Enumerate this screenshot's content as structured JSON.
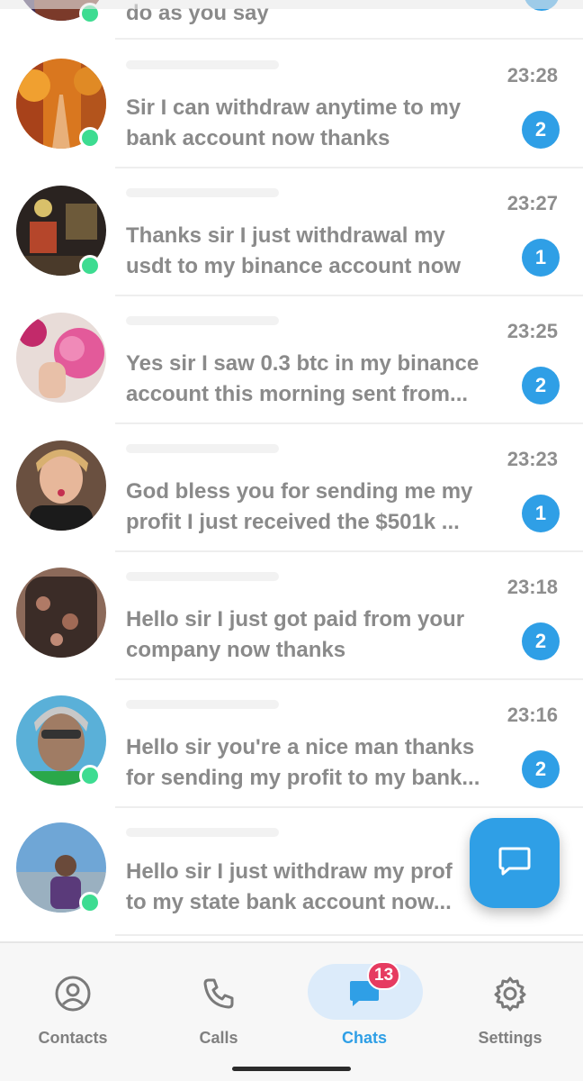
{
  "chats": [
    {
      "time": "",
      "lines": [
        "do as you say"
      ],
      "unread": "",
      "online": true,
      "avatar_colors": [
        "#3a2b57",
        "#7b3a2a"
      ]
    },
    {
      "time": "23:28",
      "lines": [
        "Sir I can withdraw anytime to my",
        "bank account now thanks"
      ],
      "unread": "2",
      "online": true,
      "avatar_colors": [
        "#d9771f",
        "#7a2f0f"
      ]
    },
    {
      "time": "23:27",
      "lines": [
        "Thanks sir I just withdrawal my",
        "usdt to my binance account now"
      ],
      "unread": "1",
      "online": true,
      "avatar_colors": [
        "#2a2320",
        "#b5462b"
      ]
    },
    {
      "time": "23:25",
      "lines": [
        "Yes sir I saw 0.3 btc in my binance",
        "account this morning sent from..."
      ],
      "unread": "2",
      "online": false,
      "avatar_colors": [
        "#e35a9a",
        "#8a2a4a"
      ]
    },
    {
      "time": "23:23",
      "lines": [
        "God bless you for sending me my",
        "profit I just received the $501k ..."
      ],
      "unread": "1",
      "online": false,
      "avatar_colors": [
        "#caa07a",
        "#2b2624"
      ]
    },
    {
      "time": "23:18",
      "lines": [
        "Hello sir I just got paid from your",
        "company now thanks"
      ],
      "unread": "2",
      "online": false,
      "avatar_colors": [
        "#3b2c27",
        "#8c6a5a"
      ]
    },
    {
      "time": "23:16",
      "lines": [
        "Hello sir you're a nice man thanks",
        "for sending my profit to my bank..."
      ],
      "unread": "2",
      "online": true,
      "avatar_colors": [
        "#5ab0d8",
        "#8a6e5c"
      ]
    },
    {
      "time": "",
      "lines": [
        "Hello sir I just withdraw my prof",
        "to my state bank account now..."
      ],
      "unread": "",
      "online": true,
      "avatar_colors": [
        "#6fa6d6",
        "#5a3a7a"
      ]
    }
  ],
  "fab": {
    "icon": "compose-message-icon"
  },
  "tabs": [
    {
      "label": "Contacts",
      "icon": "person-circle-icon",
      "active": false,
      "badge": ""
    },
    {
      "label": "Calls",
      "icon": "phone-icon",
      "active": false,
      "badge": ""
    },
    {
      "label": "Chats",
      "icon": "chat-bubble-icon",
      "active": true,
      "badge": "13"
    },
    {
      "label": "Settings",
      "icon": "gear-icon",
      "active": false,
      "badge": ""
    }
  ],
  "colors": {
    "accent": "#2f9fe6",
    "online": "#3ddc91",
    "badge_red": "#e63b60",
    "text": "#8a8a8a"
  }
}
